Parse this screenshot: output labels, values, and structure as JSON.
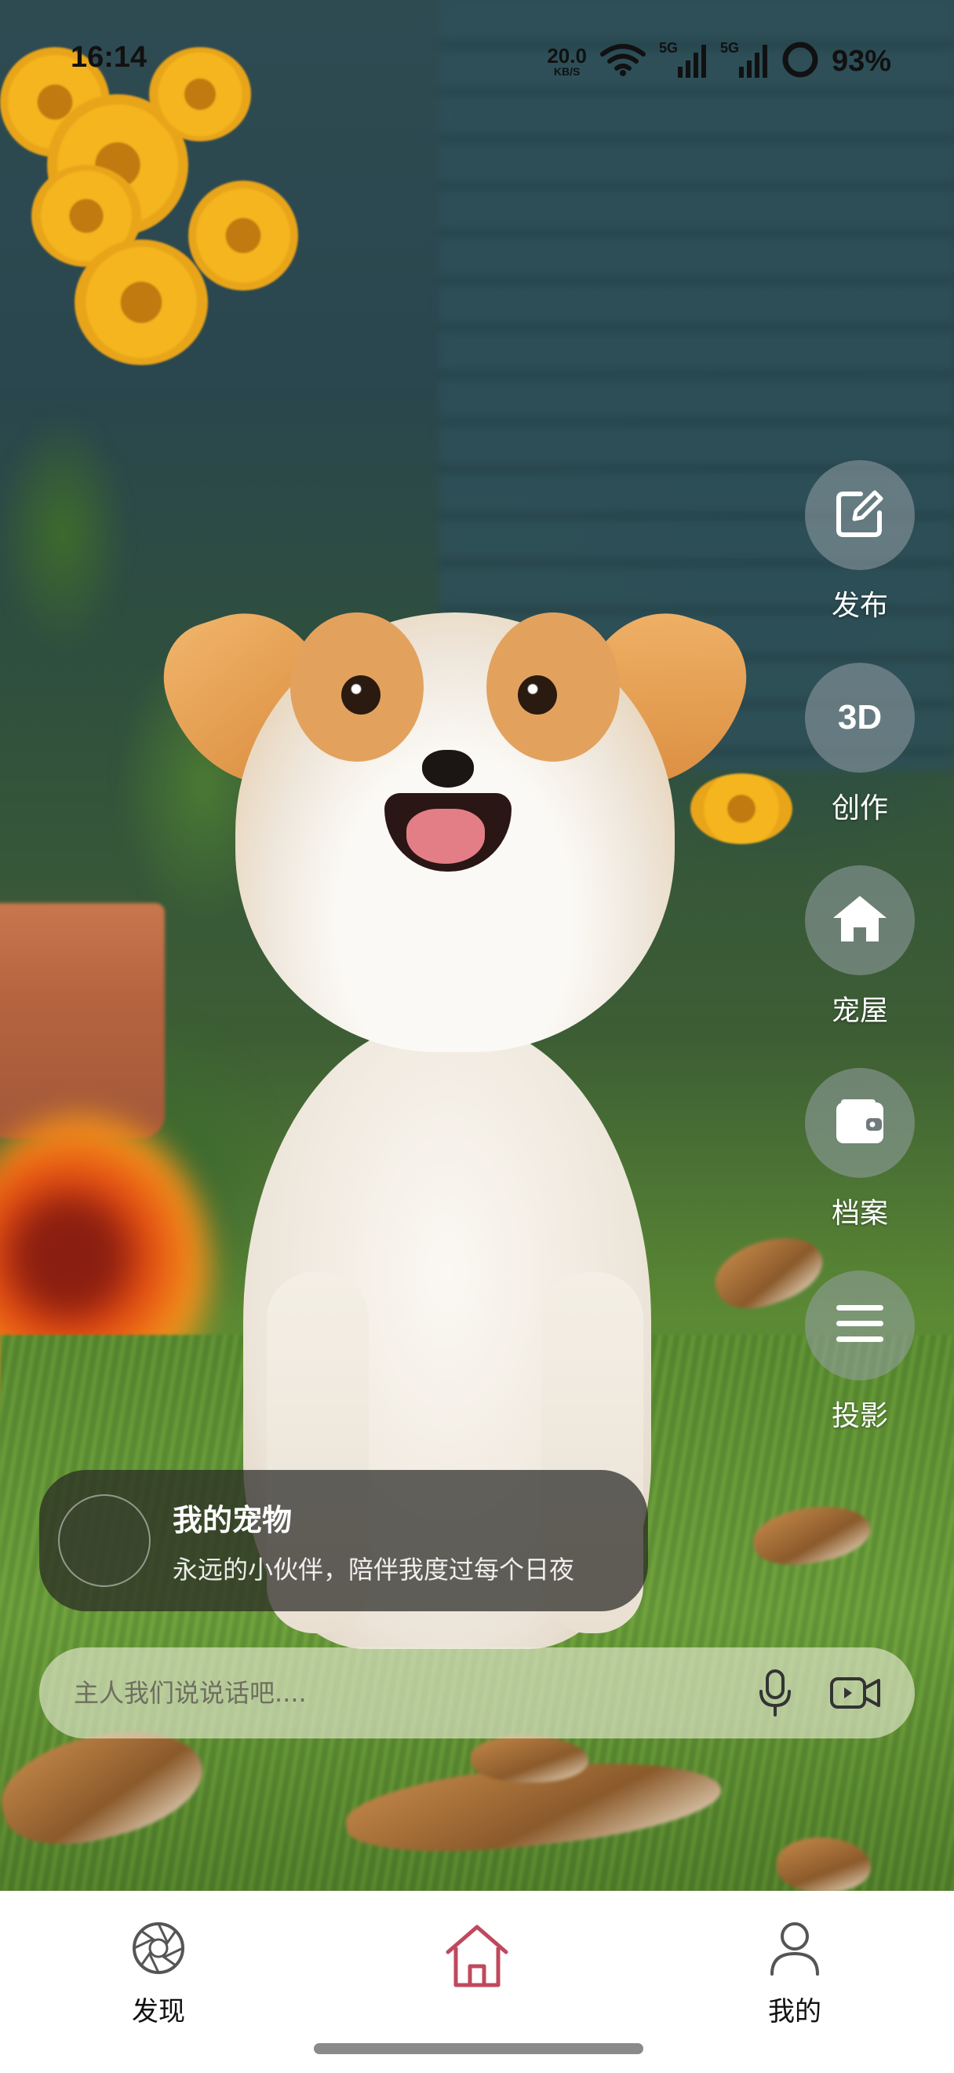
{
  "status_bar": {
    "time": "16:14",
    "net_speed_value": "20.0",
    "net_speed_unit": "KB/S",
    "network_1": "5G",
    "network_2": "5G",
    "battery": "93%",
    "icons": [
      "wifi-icon",
      "signal-icon",
      "signal-icon",
      "battery-icon"
    ]
  },
  "side_actions": [
    {
      "label": "发布",
      "icon": "edit-icon"
    },
    {
      "label": "创作",
      "icon_text": "3D"
    },
    {
      "label": "宠屋",
      "icon": "home-icon"
    },
    {
      "label": "档案",
      "icon": "wallet-icon"
    },
    {
      "label": "投影",
      "icon": "menu-icon"
    }
  ],
  "pet_card": {
    "title": "我的宠物",
    "subtitle": "永远的小伙伴，陪伴我度过每个日夜"
  },
  "chat": {
    "placeholder": "主人我们说说话吧....",
    "value": ""
  },
  "bottom_nav": {
    "items": [
      {
        "label": "发现",
        "icon": "aperture-icon",
        "active": false
      },
      {
        "label": "",
        "icon": "home-icon",
        "active": true
      },
      {
        "label": "我的",
        "icon": "person-icon",
        "active": false
      }
    ]
  },
  "colors": {
    "active_nav": "#c0485e",
    "rail_button_bg": "rgba(150,160,165,0.55)"
  }
}
